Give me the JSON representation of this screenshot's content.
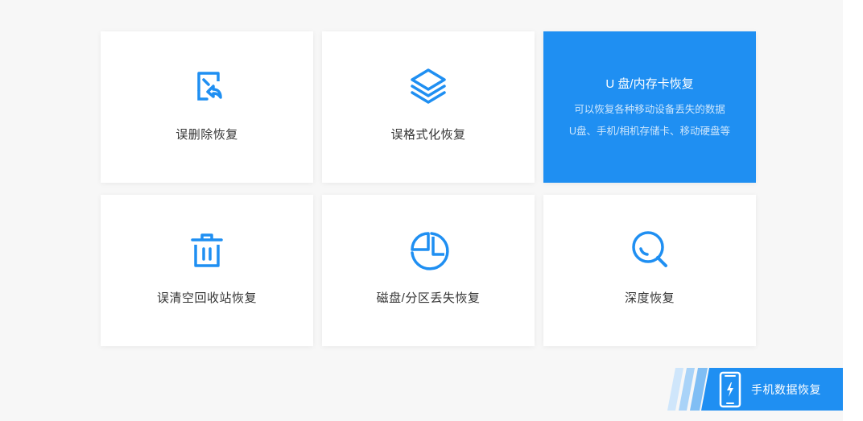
{
  "cards": [
    {
      "label": "误删除恢复",
      "icon": "file-restore-icon"
    },
    {
      "label": "误格式化恢复",
      "icon": "layers-icon"
    },
    {
      "title": "U 盘/内存卡恢复",
      "desc1": "可以恢复各种移动设备丢失的数据",
      "desc2": "U盘、手机/相机存储卡、移动硬盘等",
      "active": true
    },
    {
      "label": "误清空回收站恢复",
      "icon": "trash-icon"
    },
    {
      "label": "磁盘/分区丢失恢复",
      "icon": "pie-chart-icon"
    },
    {
      "label": "深度恢复",
      "icon": "magnifier-icon"
    }
  ],
  "mobile_recovery": {
    "label": "手机数据恢复",
    "icon": "phone-icon"
  },
  "colors": {
    "accent": "#1f8ff2",
    "background": "#f7f7f7",
    "card": "#ffffff",
    "text": "#333333"
  }
}
